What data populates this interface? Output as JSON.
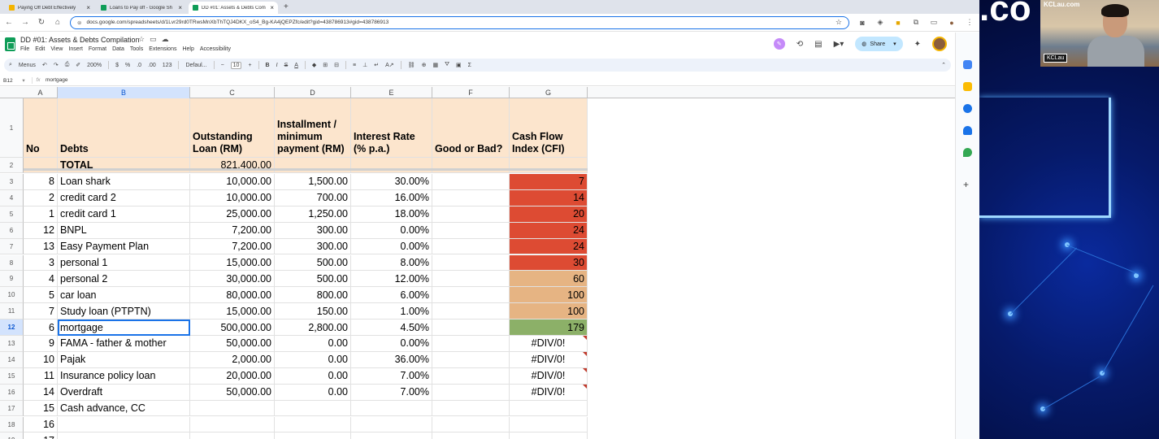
{
  "browser": {
    "tabs": [
      {
        "label": "Paying Off Debt Effectively",
        "color": "#f4b400",
        "active": false
      },
      {
        "label": "Loans to Pay off - Google Sh",
        "color": "#0f9d58",
        "active": false
      },
      {
        "label": "DD #01: Assets & Debts Com",
        "color": "#0f9d58",
        "active": true
      }
    ],
    "url": "docs.google.com/spreadsheets/d/1Lvr29rd0TRwsMnXbThTQJ4DKX_oS4_Bg-KA4jQEPZfc/edit?gid=438786913#gid=438786913"
  },
  "doc": {
    "title": "DD #01: Assets & Debts Compilation",
    "menu": [
      "File",
      "Edit",
      "View",
      "Insert",
      "Format",
      "Data",
      "Tools",
      "Extensions",
      "Help",
      "Accessibility"
    ],
    "share_label": "Share"
  },
  "toolbar": {
    "menus_label": "Menus",
    "zoom": "200%",
    "currency": "$",
    "percent": "%",
    "dec_dec": ".0",
    "dec_inc": ".00",
    "number_fmt": "123",
    "font": "Defaul...",
    "font_size": "10"
  },
  "formula_bar": {
    "cell_ref": "B12",
    "content": "mortgage"
  },
  "columns": [
    "A",
    "B",
    "C",
    "D",
    "E",
    "F",
    "G"
  ],
  "header_row": {
    "no": "No",
    "debts": "Debts",
    "outstanding": "Outstanding Loan (RM)",
    "installment": "Installment / minimum payment (RM)",
    "interest": "Interest Rate (% p.a.)",
    "good_bad": "Good or Bad?",
    "cfi": "Cash Flow Index (CFI)"
  },
  "total_row": {
    "label": "TOTAL",
    "outstanding": "821,400.00"
  },
  "row_numbers": [
    "1",
    "2",
    "3",
    "4",
    "5",
    "6",
    "7",
    "8",
    "9",
    "10",
    "11",
    "12",
    "13",
    "14",
    "15",
    "16",
    "17",
    "18",
    "19"
  ],
  "rows": [
    {
      "no": "8",
      "debt": "Loan shark",
      "loan": "10,000.00",
      "inst": "1,500.00",
      "rate": "30.00%",
      "cfi": "7",
      "color": "red"
    },
    {
      "no": "2",
      "debt": "credit card 2",
      "loan": "10,000.00",
      "inst": "700.00",
      "rate": "16.00%",
      "cfi": "14",
      "color": "red"
    },
    {
      "no": "1",
      "debt": "credit card 1",
      "loan": "25,000.00",
      "inst": "1,250.00",
      "rate": "18.00%",
      "cfi": "20",
      "color": "red"
    },
    {
      "no": "12",
      "debt": "BNPL",
      "loan": "7,200.00",
      "inst": "300.00",
      "rate": "0.00%",
      "cfi": "24",
      "color": "red"
    },
    {
      "no": "13",
      "debt": "Easy Payment Plan",
      "loan": "7,200.00",
      "inst": "300.00",
      "rate": "0.00%",
      "cfi": "24",
      "color": "red"
    },
    {
      "no": "3",
      "debt": "personal 1",
      "loan": "15,000.00",
      "inst": "500.00",
      "rate": "8.00%",
      "cfi": "30",
      "color": "red"
    },
    {
      "no": "4",
      "debt": "personal 2",
      "loan": "30,000.00",
      "inst": "500.00",
      "rate": "12.00%",
      "cfi": "60",
      "color": "org"
    },
    {
      "no": "5",
      "debt": "car loan",
      "loan": "80,000.00",
      "inst": "800.00",
      "rate": "6.00%",
      "cfi": "100",
      "color": "org"
    },
    {
      "no": "7",
      "debt": "Study loan (PTPTN)",
      "loan": "15,000.00",
      "inst": "150.00",
      "rate": "1.00%",
      "cfi": "100",
      "color": "org"
    },
    {
      "no": "6",
      "debt": "mortgage",
      "loan": "500,000.00",
      "inst": "2,800.00",
      "rate": "4.50%",
      "cfi": "179",
      "color": "grn"
    },
    {
      "no": "9",
      "debt": "FAMA - father & mother",
      "loan": "50,000.00",
      "inst": "0.00",
      "rate": "0.00%",
      "cfi": "#DIV/0!",
      "color": ""
    },
    {
      "no": "10",
      "debt": "Pajak",
      "loan": "2,000.00",
      "inst": "0.00",
      "rate": "36.00%",
      "cfi": "#DIV/0!",
      "color": ""
    },
    {
      "no": "11",
      "debt": "Insurance policy loan",
      "loan": "20,000.00",
      "inst": "0.00",
      "rate": "7.00%",
      "cfi": "#DIV/0!",
      "color": ""
    },
    {
      "no": "14",
      "debt": "Overdraft",
      "loan": "50,000.00",
      "inst": "0.00",
      "rate": "7.00%",
      "cfi": "#DIV/0!",
      "color": ""
    },
    {
      "no": "15",
      "debt": "Cash advance, CC",
      "loan": "",
      "inst": "",
      "rate": "",
      "cfi": "",
      "color": ""
    },
    {
      "no": "16",
      "debt": "",
      "loan": "",
      "inst": "",
      "rate": "",
      "cfi": "",
      "color": ""
    },
    {
      "no": "17",
      "debt": "",
      "loan": "",
      "inst": "",
      "rate": "",
      "cfi": "",
      "color": ""
    }
  ],
  "video": {
    "overlay_text": ".co",
    "site": "KCLau.com",
    "logo": "KCLau"
  }
}
